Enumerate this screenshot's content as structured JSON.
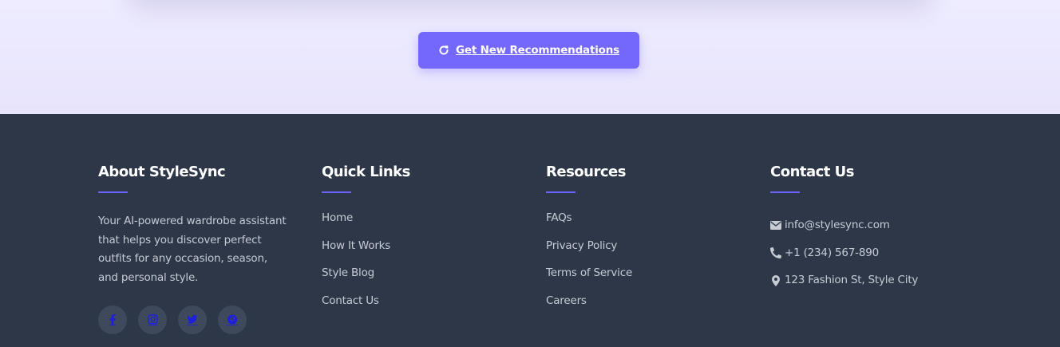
{
  "recommendations": {
    "button_label": "Get New Recommendations",
    "button_icon": "refresh-icon"
  },
  "footer": {
    "about": {
      "title": "About StyleSync",
      "text": "Your AI-powered wardrobe assistant that helps you discover perfect outfits for any occasion, season, and personal style.",
      "social": [
        {
          "name": "facebook-icon"
        },
        {
          "name": "instagram-icon"
        },
        {
          "name": "twitter-icon"
        },
        {
          "name": "pinterest-icon"
        }
      ]
    },
    "quick_links": {
      "title": "Quick Links",
      "items": [
        "Home",
        "How It Works",
        "Style Blog",
        "Contact Us"
      ]
    },
    "resources": {
      "title": "Resources",
      "items": [
        "FAQs",
        "Privacy Policy",
        "Terms of Service",
        "Careers"
      ]
    },
    "contact": {
      "title": "Contact Us",
      "email": "info@stylesync.com",
      "phone": "+1 (234) 567-890",
      "address": "123 Fashion St, Style City"
    }
  },
  "colors": {
    "accent": "#6c63ff",
    "button": "#7468fc",
    "footer_bg": "#2d3748",
    "top_bg": "#ebe8fd"
  }
}
